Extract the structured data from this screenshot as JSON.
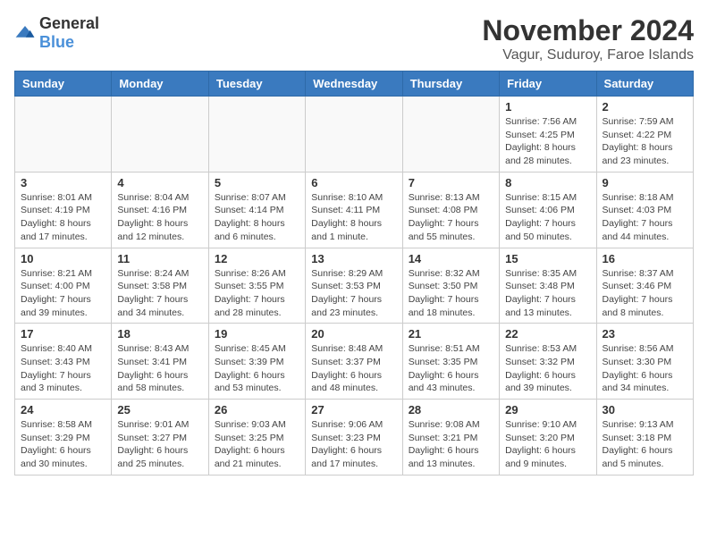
{
  "logo": {
    "general": "General",
    "blue": "Blue"
  },
  "header": {
    "month": "November 2024",
    "location": "Vagur, Suduroy, Faroe Islands"
  },
  "weekdays": [
    "Sunday",
    "Monday",
    "Tuesday",
    "Wednesday",
    "Thursday",
    "Friday",
    "Saturday"
  ],
  "weeks": [
    [
      {
        "day": "",
        "info": ""
      },
      {
        "day": "",
        "info": ""
      },
      {
        "day": "",
        "info": ""
      },
      {
        "day": "",
        "info": ""
      },
      {
        "day": "",
        "info": ""
      },
      {
        "day": "1",
        "info": "Sunrise: 7:56 AM\nSunset: 4:25 PM\nDaylight: 8 hours and 28 minutes."
      },
      {
        "day": "2",
        "info": "Sunrise: 7:59 AM\nSunset: 4:22 PM\nDaylight: 8 hours and 23 minutes."
      }
    ],
    [
      {
        "day": "3",
        "info": "Sunrise: 8:01 AM\nSunset: 4:19 PM\nDaylight: 8 hours and 17 minutes."
      },
      {
        "day": "4",
        "info": "Sunrise: 8:04 AM\nSunset: 4:16 PM\nDaylight: 8 hours and 12 minutes."
      },
      {
        "day": "5",
        "info": "Sunrise: 8:07 AM\nSunset: 4:14 PM\nDaylight: 8 hours and 6 minutes."
      },
      {
        "day": "6",
        "info": "Sunrise: 8:10 AM\nSunset: 4:11 PM\nDaylight: 8 hours and 1 minute."
      },
      {
        "day": "7",
        "info": "Sunrise: 8:13 AM\nSunset: 4:08 PM\nDaylight: 7 hours and 55 minutes."
      },
      {
        "day": "8",
        "info": "Sunrise: 8:15 AM\nSunset: 4:06 PM\nDaylight: 7 hours and 50 minutes."
      },
      {
        "day": "9",
        "info": "Sunrise: 8:18 AM\nSunset: 4:03 PM\nDaylight: 7 hours and 44 minutes."
      }
    ],
    [
      {
        "day": "10",
        "info": "Sunrise: 8:21 AM\nSunset: 4:00 PM\nDaylight: 7 hours and 39 minutes."
      },
      {
        "day": "11",
        "info": "Sunrise: 8:24 AM\nSunset: 3:58 PM\nDaylight: 7 hours and 34 minutes."
      },
      {
        "day": "12",
        "info": "Sunrise: 8:26 AM\nSunset: 3:55 PM\nDaylight: 7 hours and 28 minutes."
      },
      {
        "day": "13",
        "info": "Sunrise: 8:29 AM\nSunset: 3:53 PM\nDaylight: 7 hours and 23 minutes."
      },
      {
        "day": "14",
        "info": "Sunrise: 8:32 AM\nSunset: 3:50 PM\nDaylight: 7 hours and 18 minutes."
      },
      {
        "day": "15",
        "info": "Sunrise: 8:35 AM\nSunset: 3:48 PM\nDaylight: 7 hours and 13 minutes."
      },
      {
        "day": "16",
        "info": "Sunrise: 8:37 AM\nSunset: 3:46 PM\nDaylight: 7 hours and 8 minutes."
      }
    ],
    [
      {
        "day": "17",
        "info": "Sunrise: 8:40 AM\nSunset: 3:43 PM\nDaylight: 7 hours and 3 minutes."
      },
      {
        "day": "18",
        "info": "Sunrise: 8:43 AM\nSunset: 3:41 PM\nDaylight: 6 hours and 58 minutes."
      },
      {
        "day": "19",
        "info": "Sunrise: 8:45 AM\nSunset: 3:39 PM\nDaylight: 6 hours and 53 minutes."
      },
      {
        "day": "20",
        "info": "Sunrise: 8:48 AM\nSunset: 3:37 PM\nDaylight: 6 hours and 48 minutes."
      },
      {
        "day": "21",
        "info": "Sunrise: 8:51 AM\nSunset: 3:35 PM\nDaylight: 6 hours and 43 minutes."
      },
      {
        "day": "22",
        "info": "Sunrise: 8:53 AM\nSunset: 3:32 PM\nDaylight: 6 hours and 39 minutes."
      },
      {
        "day": "23",
        "info": "Sunrise: 8:56 AM\nSunset: 3:30 PM\nDaylight: 6 hours and 34 minutes."
      }
    ],
    [
      {
        "day": "24",
        "info": "Sunrise: 8:58 AM\nSunset: 3:29 PM\nDaylight: 6 hours and 30 minutes."
      },
      {
        "day": "25",
        "info": "Sunrise: 9:01 AM\nSunset: 3:27 PM\nDaylight: 6 hours and 25 minutes."
      },
      {
        "day": "26",
        "info": "Sunrise: 9:03 AM\nSunset: 3:25 PM\nDaylight: 6 hours and 21 minutes."
      },
      {
        "day": "27",
        "info": "Sunrise: 9:06 AM\nSunset: 3:23 PM\nDaylight: 6 hours and 17 minutes."
      },
      {
        "day": "28",
        "info": "Sunrise: 9:08 AM\nSunset: 3:21 PM\nDaylight: 6 hours and 13 minutes."
      },
      {
        "day": "29",
        "info": "Sunrise: 9:10 AM\nSunset: 3:20 PM\nDaylight: 6 hours and 9 minutes."
      },
      {
        "day": "30",
        "info": "Sunrise: 9:13 AM\nSunset: 3:18 PM\nDaylight: 6 hours and 5 minutes."
      }
    ]
  ]
}
